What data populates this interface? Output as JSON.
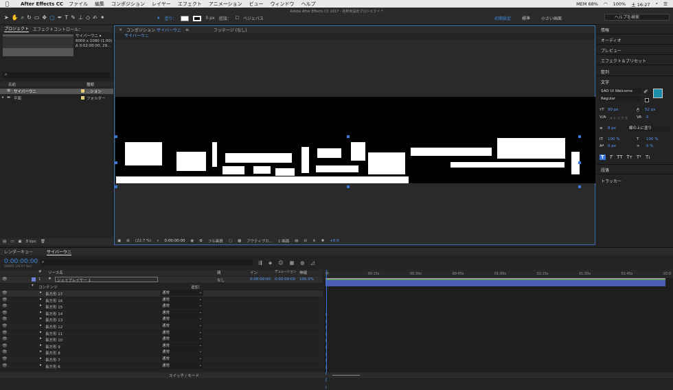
{
  "menubar": {
    "app": "After Effects CC",
    "menus": [
      "ファイル",
      "編集",
      "コンポジション",
      "レイヤー",
      "エフェクト",
      "アニメーション",
      "ビュー",
      "ウィンドウ",
      "ヘルプ"
    ],
    "battery": "100%",
    "time": "土 16:27",
    "net": "MEM 68%"
  },
  "toolbar": {
    "window_title": "Adobe After Effects CC 2017 - 名称未設定プロジェクト *",
    "fill_label": "塗り：",
    "stroke_px": "0 px",
    "add_label": "追加：",
    "bezier_label": "ベジェパス",
    "workspaces": [
      "初期設定",
      "標準",
      "小さい画面"
    ],
    "help_search": "ヘルプを検索"
  },
  "project": {
    "tabs": [
      "プロジェクト",
      "エフェクトコントロール："
    ],
    "comp_name": "サイバーウニ ▾",
    "comp_size": "6000 x 1080 (1.00)",
    "comp_dur": "Δ 0:02:00:00, 29...",
    "col_name": "名前",
    "col_type": "種類",
    "items": [
      {
        "name": "サイバーウニ",
        "type": "...ション",
        "selected": true
      },
      {
        "name": "平面",
        "type": "フォルダー",
        "selected": false
      }
    ],
    "bpc": "8 bpc"
  },
  "comp": {
    "tab_prefix": "コンポジション",
    "tab_name": "サイバーウニ",
    "footage_tab": "フッテージ (なし)",
    "sub_tab": "サイバーウニ",
    "zoom": "(22.7 %)",
    "time": "0:00:00:00",
    "quality": "フル画質",
    "camera": "アクティブカ...",
    "views": "1 画面",
    "exposure": "+0.0"
  },
  "right": {
    "panels": [
      "情報",
      "オーディオ",
      "プレビュー",
      "エフェクト＆プリセット",
      "整列",
      "文字"
    ],
    "font": "SAO UI Welcome",
    "style": "Regular",
    "font_size": "90 px",
    "leading": "52 px",
    "kerning": "メトリクス",
    "tracking": "0",
    "stroke_size": "8 px",
    "stroke_mode": "線の上に塗り",
    "vscale": "100 %",
    "hscale": "100 %",
    "baseline": "0 px",
    "tsume": "0 %",
    "styles": [
      "T",
      "T",
      "TT",
      "Tт",
      "T¹",
      "T₁"
    ],
    "para": "段落",
    "tracker": "トラッカー",
    "accent": "#1d8fa8"
  },
  "timeline": {
    "tabs": [
      "レンダーキュー",
      "サイバーウニ"
    ],
    "timecode": "0:00:00:00",
    "fps": "00000 (29.97 fps)",
    "col_num": "#",
    "col_source": "ソース名",
    "col_parent": "親",
    "col_in": "イン",
    "col_dur": "デュレーション",
    "col_stretch": "伸縮",
    "layer": {
      "num": "1",
      "name": "シェイプレイヤー 1",
      "parent": "なし",
      "in": "0:00:00:00",
      "dur": "0:02:00:00",
      "stretch": "100.0%"
    },
    "contents": "コンテンツ",
    "add": "追加：",
    "shapes": [
      "長方形 17",
      "長方形 16",
      "長方形 15",
      "長方形 14",
      "長方形 13",
      "長方形 12",
      "長方形 11",
      "長方形 10",
      "長方形 9",
      "長方形 8",
      "長方形 7",
      "長方形 6"
    ],
    "mode": "通常",
    "ruler": [
      "0f",
      "00:15s",
      "00:30s",
      "00:45s",
      "01:00s",
      "01:15s",
      "01:30s",
      "01:45s",
      "02:0"
    ],
    "switch_mode": "スイッチ / モード"
  }
}
